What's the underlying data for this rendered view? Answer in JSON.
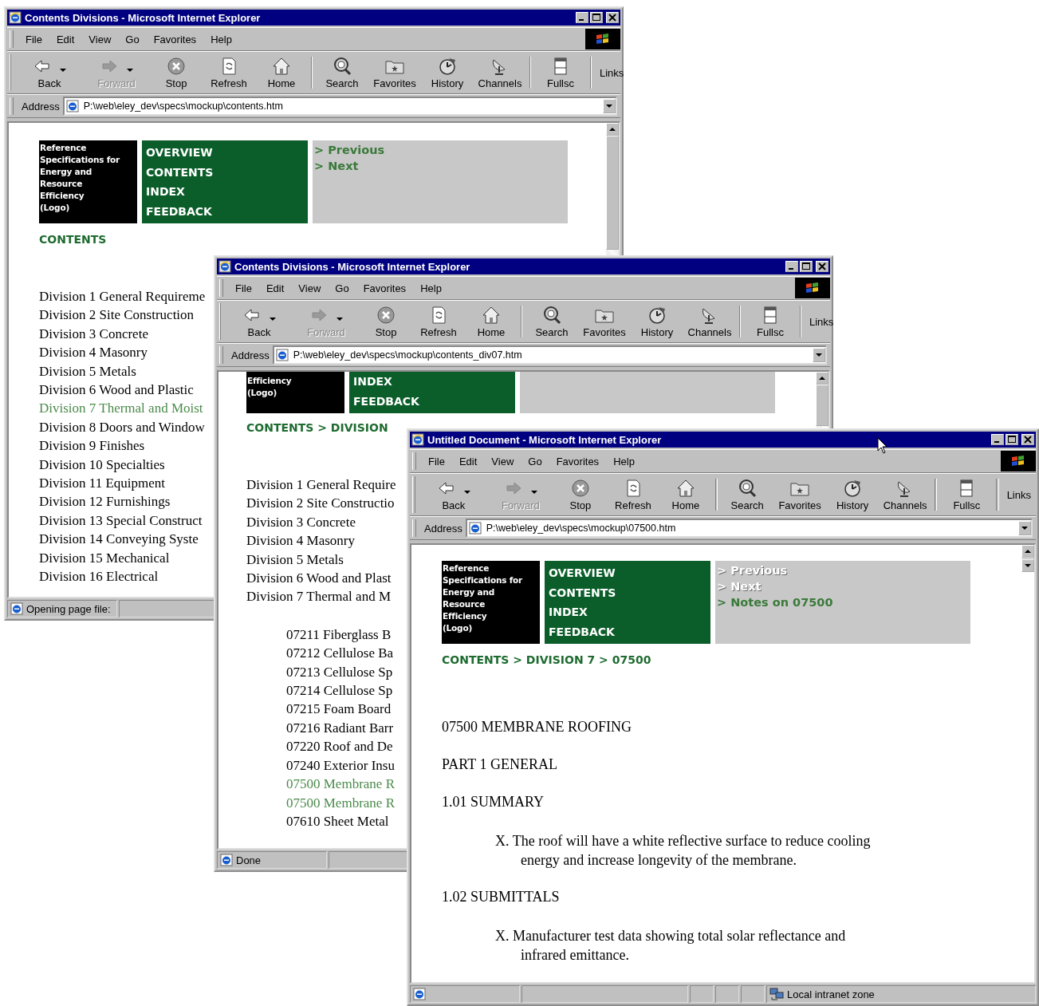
{
  "windows": [
    {
      "title": "Contents Divisions - Microsoft Internet Explorer",
      "menu": [
        "File",
        "Edit",
        "View",
        "Go",
        "Favorites",
        "Help"
      ],
      "toolbar": [
        [
          {
            "kind": "back",
            "label": "Back",
            "disabled": false,
            "dropdown": true
          },
          {
            "kind": "forward",
            "label": "Forward",
            "disabled": true,
            "dropdown": true
          },
          {
            "kind": "stop",
            "label": "Stop",
            "disabled": false,
            "dropdown": false
          },
          {
            "kind": "refresh",
            "label": "Refresh",
            "disabled": false,
            "dropdown": false
          },
          {
            "kind": "home",
            "label": "Home",
            "disabled": false,
            "dropdown": false
          }
        ],
        [
          {
            "kind": "search",
            "label": "Search",
            "disabled": false,
            "dropdown": false
          },
          {
            "kind": "favorites",
            "label": "Favorites",
            "disabled": false,
            "dropdown": false
          },
          {
            "kind": "history",
            "label": "History",
            "disabled": false,
            "dropdown": false
          },
          {
            "kind": "channels",
            "label": "Channels",
            "disabled": false,
            "dropdown": false
          }
        ],
        [
          {
            "kind": "fullscreen",
            "label": "Fullsc",
            "disabled": false,
            "dropdown": false
          }
        ]
      ],
      "links": "Links",
      "address_label": "Address",
      "address": "P:\\web\\eley_dev\\specs\\mockup\\contents.htm",
      "page": {
        "logo": [
          "Reference",
          "Specifications for",
          "Energy and",
          "Resource",
          "Efficiency",
          "(Logo)"
        ],
        "nav": [
          "OVERVIEW",
          "CONTENTS",
          "INDEX",
          "FEEDBACK"
        ],
        "side_links": [
          {
            "label": "> Previous",
            "disabled": false
          },
          {
            "label": "> Next",
            "disabled": false
          }
        ],
        "breadcrumb": "CONTENTS",
        "blocks": [
          {
            "kind": "division_list",
            "items": [
              {
                "label": "Division 1 General Requireme",
                "visited": false
              },
              {
                "label": "Division 2 Site Construction",
                "visited": false
              },
              {
                "label": "Division 3 Concrete",
                "visited": false
              },
              {
                "label": "Division 4 Masonry",
                "visited": false
              },
              {
                "label": "Division 5 Metals",
                "visited": false
              },
              {
                "label": "Division 6 Wood and Plastic",
                "visited": false
              },
              {
                "label": "Division 7 Thermal and Moist",
                "visited": true
              },
              {
                "label": "Division 8 Doors and Window",
                "visited": false
              },
              {
                "label": "Division 9 Finishes",
                "visited": false
              },
              {
                "label": "Division 10 Specialties",
                "visited": false
              },
              {
                "label": "Division 11 Equipment",
                "visited": false
              },
              {
                "label": "Division 12 Furnishings",
                "visited": false
              },
              {
                "label": "Division 13 Special Construct",
                "visited": false
              },
              {
                "label": "Division 14 Conveying Syste",
                "visited": false
              },
              {
                "label": "Division 15 Mechanical",
                "visited": false
              },
              {
                "label": "Division 16 Electrical",
                "visited": false
              }
            ]
          }
        ]
      },
      "status": {
        "text": "Opening page file:"
      }
    },
    {
      "title": "Contents Divisions - Microsoft Internet Explorer",
      "menu": [
        "File",
        "Edit",
        "View",
        "Go",
        "Favorites",
        "Help"
      ],
      "toolbar": [
        [
          {
            "kind": "back",
            "label": "Back",
            "disabled": false,
            "dropdown": true
          },
          {
            "kind": "forward",
            "label": "Forward",
            "disabled": true,
            "dropdown": true
          },
          {
            "kind": "stop",
            "label": "Stop",
            "disabled": false,
            "dropdown": false
          },
          {
            "kind": "refresh",
            "label": "Refresh",
            "disabled": false,
            "dropdown": false
          },
          {
            "kind": "home",
            "label": "Home",
            "disabled": false,
            "dropdown": false
          }
        ],
        [
          {
            "kind": "search",
            "label": "Search",
            "disabled": false,
            "dropdown": false
          },
          {
            "kind": "favorites",
            "label": "Favorites",
            "disabled": false,
            "dropdown": false
          },
          {
            "kind": "history",
            "label": "History",
            "disabled": false,
            "dropdown": false
          },
          {
            "kind": "channels",
            "label": "Channels",
            "disabled": false,
            "dropdown": false
          }
        ],
        [
          {
            "kind": "fullscreen",
            "label": "Fullsc",
            "disabled": false,
            "dropdown": false
          }
        ]
      ],
      "links": "Links",
      "address_label": "Address",
      "address": "P:\\web\\eley_dev\\specs\\mockup\\contents_div07.htm",
      "page": {
        "logo": [
          "Efficiency",
          "(Logo)"
        ],
        "nav": [
          "INDEX",
          "FEEDBACK"
        ],
        "breadcrumb": "CONTENTS > DIVISION",
        "blocks": [
          {
            "kind": "division_list",
            "items": [
              {
                "label": "Division 1 General Require",
                "visited": false
              },
              {
                "label": "Division 2 Site Constructio",
                "visited": false
              },
              {
                "label": "Division 3 Concrete",
                "visited": false
              },
              {
                "label": "Division 4 Masonry",
                "visited": false
              },
              {
                "label": "Division 5 Metals",
                "visited": false
              },
              {
                "label": "Division 6 Wood and Plast",
                "visited": false
              },
              {
                "label": "Division 7 Thermal and M",
                "visited": false
              }
            ]
          },
          {
            "kind": "section_list",
            "items": [
              {
                "label": "07211 Fiberglass B",
                "visited": false
              },
              {
                "label": "07212 Cellulose Ba",
                "visited": false
              },
              {
                "label": "07213 Cellulose Sp",
                "visited": false
              },
              {
                "label": "07214 Cellulose Sp",
                "visited": false
              },
              {
                "label": "07215 Foam Board",
                "visited": false
              },
              {
                "label": "07216 Radiant Barr",
                "visited": false
              },
              {
                "label": "07220 Roof and De",
                "visited": false
              },
              {
                "label": "07240 Exterior Insu",
                "visited": false
              },
              {
                "label": "07500 Membrane R",
                "visited": true
              },
              {
                "label": "07500 Membrane R",
                "visited": true
              },
              {
                "label": "07610 Sheet Metal",
                "visited": false
              }
            ]
          }
        ]
      },
      "status": {
        "text": "Done"
      }
    },
    {
      "title": "Untitled Document - Microsoft Internet Explorer",
      "menu": [
        "File",
        "Edit",
        "View",
        "Go",
        "Favorites",
        "Help"
      ],
      "toolbar": [
        [
          {
            "kind": "back",
            "label": "Back",
            "disabled": false,
            "dropdown": true
          },
          {
            "kind": "forward",
            "label": "Forward",
            "disabled": true,
            "dropdown": true
          },
          {
            "kind": "stop",
            "label": "Stop",
            "disabled": false,
            "dropdown": false
          },
          {
            "kind": "refresh",
            "label": "Refresh",
            "disabled": false,
            "dropdown": false
          },
          {
            "kind": "home",
            "label": "Home",
            "disabled": false,
            "dropdown": false
          }
        ],
        [
          {
            "kind": "search",
            "label": "Search",
            "disabled": false,
            "dropdown": false
          },
          {
            "kind": "favorites",
            "label": "Favorites",
            "disabled": false,
            "dropdown": false
          },
          {
            "kind": "history",
            "label": "History",
            "disabled": false,
            "dropdown": false
          },
          {
            "kind": "channels",
            "label": "Channels",
            "disabled": false,
            "dropdown": false
          }
        ],
        [
          {
            "kind": "fullscreen",
            "label": "Fullsc",
            "disabled": false,
            "dropdown": false
          }
        ]
      ],
      "links": "Links",
      "address_label": "Address",
      "address": "P:\\web\\eley_dev\\specs\\mockup\\07500.htm",
      "page": {
        "logo": [
          "Reference",
          "Specifications for",
          "Energy and",
          "Resource",
          "Efficiency",
          "(Logo)"
        ],
        "nav": [
          "OVERVIEW",
          "CONTENTS",
          "INDEX",
          "FEEDBACK"
        ],
        "side_links": [
          {
            "label": "> Previous",
            "disabled": true
          },
          {
            "label": "> Next",
            "disabled": true
          },
          {
            "label": "> Notes on 07500",
            "disabled": false
          }
        ],
        "breadcrumb": "CONTENTS > DIVISION 7 > 07500",
        "blocks": [
          {
            "kind": "heading",
            "text": "07500 MEMBRANE ROOFING"
          },
          {
            "kind": "heading",
            "text": "PART 1 GENERAL"
          },
          {
            "kind": "heading",
            "text": "1.01 SUMMARY"
          },
          {
            "kind": "clause",
            "text": "X. The roof will have a white reflective surface to reduce cooling energy and increase longevity of the membrane."
          },
          {
            "kind": "heading",
            "text": "1.02 SUBMITTALS"
          },
          {
            "kind": "clause",
            "text": "X. Manufacturer test data showing total solar reflectance and infrared emittance."
          }
        ]
      },
      "status": {
        "zone": "Local intranet zone"
      }
    }
  ]
}
